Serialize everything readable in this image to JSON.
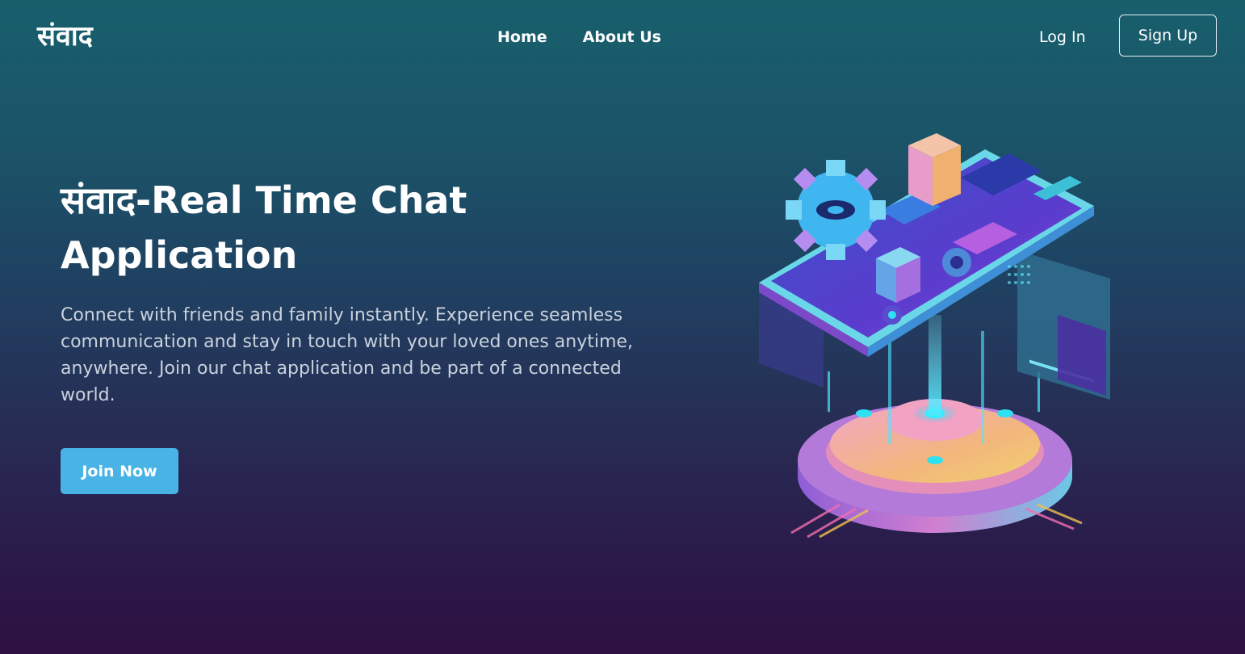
{
  "nav": {
    "logo": "संवाद",
    "links": [
      "Home",
      "About Us"
    ],
    "login_label": "Log In",
    "signup_label": "Sign Up"
  },
  "hero": {
    "title_line1": "संवाद-Real Time Chat",
    "title_line2": "Application",
    "description": "Connect with friends and family instantly. Experience seamless communication and stay in touch with your loved ones anytime, anywhere. Join our chat application and be part of a connected world.",
    "join_label": "Join Now"
  },
  "colors": {
    "bg_top": "#185f6c",
    "bg_bottom": "#2e1042",
    "accent": "#48b3e4",
    "text": "#ffffff",
    "muted_text": "#c9d2dc"
  },
  "icons": [
    "isometric-chat-phone-illustration",
    "gear-icon"
  ]
}
